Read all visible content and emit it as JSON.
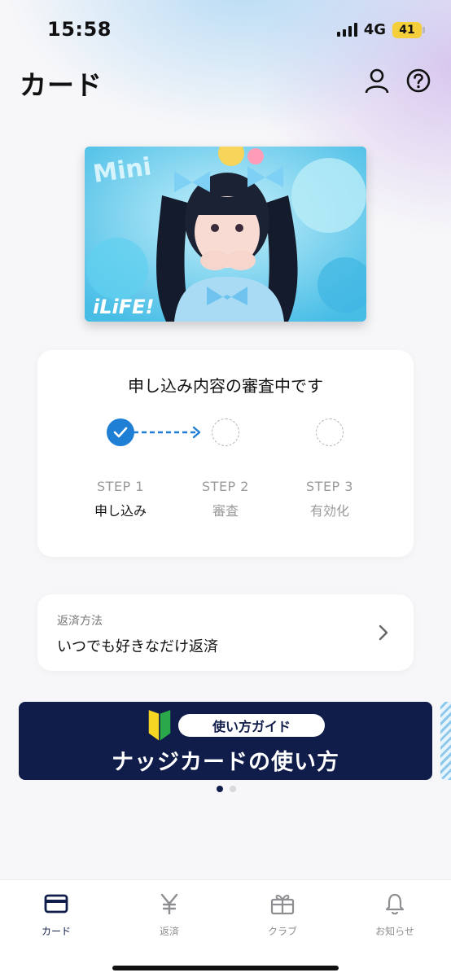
{
  "status_bar": {
    "time": "15:58",
    "network": "4G",
    "battery": "41"
  },
  "header": {
    "title": "カード",
    "icons": {
      "profile": "person-icon",
      "help": "help-circle-icon"
    }
  },
  "card": {
    "logo_text": "iLiFE!",
    "art_text": "Mini"
  },
  "progress": {
    "title": "申し込み内容の審査中です",
    "steps": [
      {
        "num": "STEP 1",
        "label": "申し込み",
        "state": "done"
      },
      {
        "num": "STEP 2",
        "label": "審査",
        "state": "pending"
      },
      {
        "num": "STEP 3",
        "label": "有効化",
        "state": "pending"
      }
    ]
  },
  "repayment": {
    "label": "返済方法",
    "value": "いつでも好きなだけ返済"
  },
  "guide_banner": {
    "tag": "使い方ガイド",
    "title": "ナッジカードの使い方"
  },
  "pager": {
    "pages": 2,
    "current": 1
  },
  "tab_bar": {
    "items": [
      {
        "label": "カード",
        "icon": "card-icon",
        "active": true
      },
      {
        "label": "返済",
        "icon": "yen-icon",
        "active": false
      },
      {
        "label": "クラブ",
        "icon": "gift-icon",
        "active": false
      },
      {
        "label": "お知らせ",
        "icon": "bell-icon",
        "active": false
      }
    ]
  },
  "colors": {
    "accent": "#1f7fd4",
    "navy": "#101c4a",
    "muted": "#9a9a9a",
    "battery": "#f5cf3a"
  }
}
